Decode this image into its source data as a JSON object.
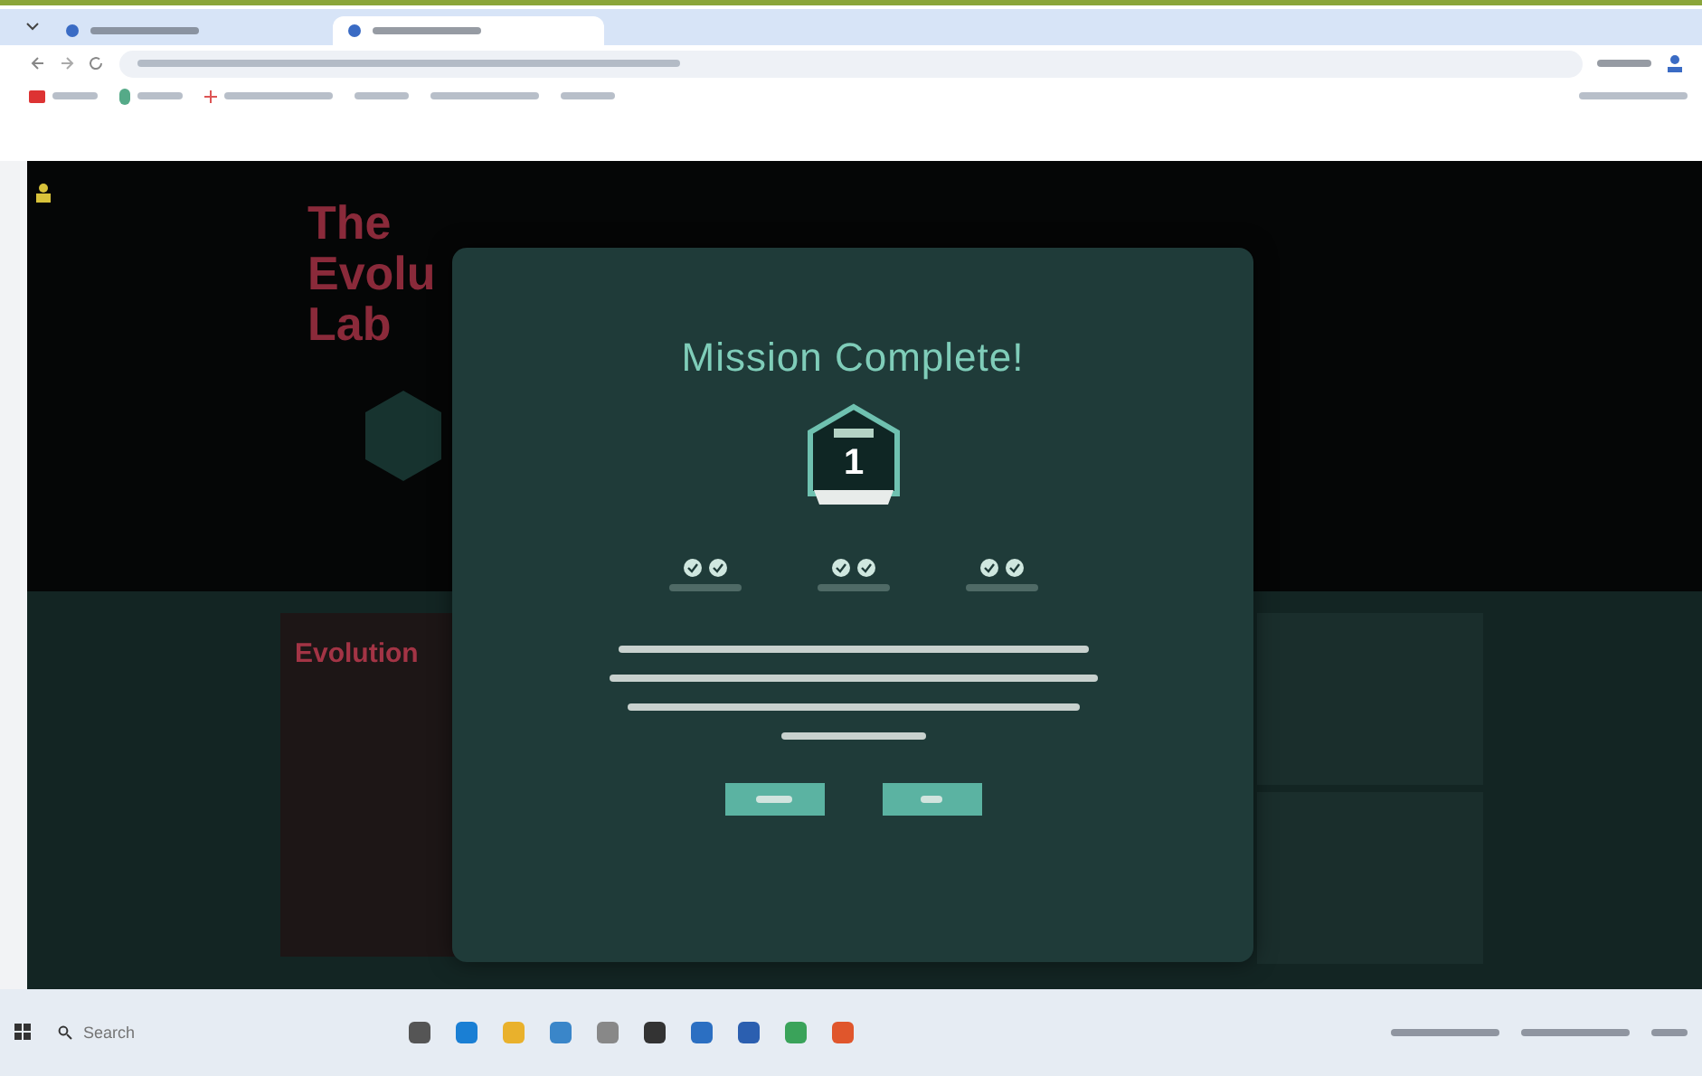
{
  "browser": {
    "tabs": [
      {
        "selected": false
      },
      {
        "selected": true
      }
    ]
  },
  "page": {
    "hero_title": [
      "The",
      "Evolu",
      "Lab"
    ],
    "section_title": "Evolution"
  },
  "modal": {
    "title": "Mission Complete!",
    "badge_number": "1",
    "achievements": [
      {
        "earned": true
      },
      {
        "earned": true
      },
      {
        "earned": true
      }
    ]
  },
  "taskbar": {
    "search": {
      "placeholder": "Search"
    }
  }
}
